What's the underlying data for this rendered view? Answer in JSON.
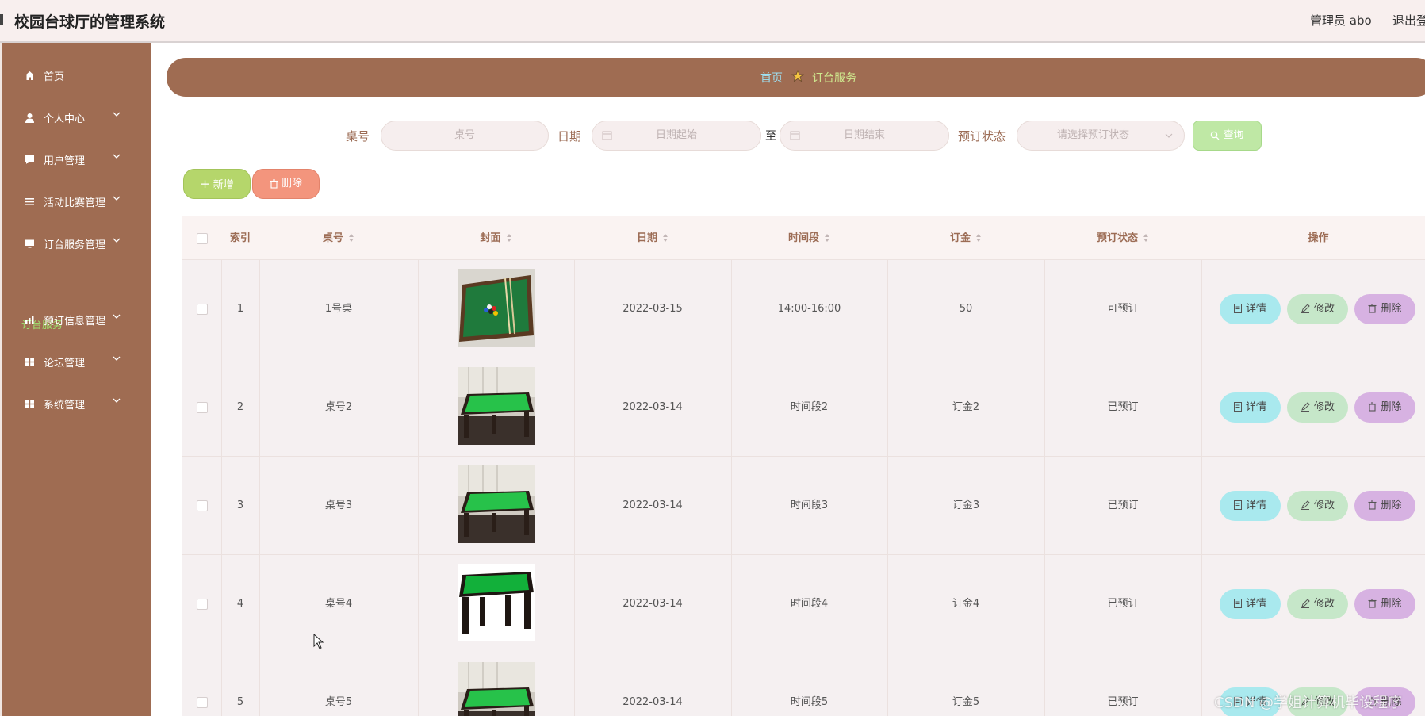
{
  "header": {
    "title": "校园台球厅的管理系统",
    "admin": "管理员 abo",
    "logout": "退出登"
  },
  "sidebar": {
    "items": [
      {
        "label": "首页",
        "icon": "home-icon"
      },
      {
        "label": "个人中心",
        "icon": "user-icon"
      },
      {
        "label": "用户管理",
        "icon": "chat-icon"
      },
      {
        "label": "活动比赛管理",
        "icon": "list-icon"
      },
      {
        "label": "订台服务管理",
        "icon": "monitor-icon"
      },
      {
        "label": "预订信息管理",
        "icon": "chart-icon"
      },
      {
        "label": "论坛管理",
        "icon": "grid-icon"
      },
      {
        "label": "系统管理",
        "icon": "grid-icon"
      }
    ],
    "active_sub": "订台服务"
  },
  "breadcrumb": {
    "home": "首页",
    "current": "订台服务"
  },
  "search": {
    "table_label": "桌号",
    "table_placeholder": "桌号",
    "date_label": "日期",
    "date_start_placeholder": "日期起始",
    "date_sep": "至",
    "date_end_placeholder": "日期结束",
    "status_label": "预订状态",
    "status_placeholder": "请选择预订状态",
    "query_label": "查询"
  },
  "actions": {
    "add_label": "新增",
    "delete_label": "删除"
  },
  "table": {
    "columns": [
      "索引",
      "桌号",
      "封面",
      "日期",
      "时间段",
      "订金",
      "预订状态",
      "操作"
    ],
    "rows": [
      {
        "index": "1",
        "table_no": "1号桌",
        "cover": "pool-table-top-view",
        "date": "2022-03-15",
        "period": "14:00-16:00",
        "deposit": "50",
        "status": "可预订"
      },
      {
        "index": "2",
        "table_no": "桌号2",
        "cover": "green-pool-table-room",
        "date": "2022-03-14",
        "period": "时间段2",
        "deposit": "订金2",
        "status": "已预订"
      },
      {
        "index": "3",
        "table_no": "桌号3",
        "cover": "green-pool-table-room",
        "date": "2022-03-14",
        "period": "时间段3",
        "deposit": "订金3",
        "status": "已预订"
      },
      {
        "index": "4",
        "table_no": "桌号4",
        "cover": "green-pool-table-white",
        "date": "2022-03-14",
        "period": "时间段4",
        "deposit": "订金4",
        "status": "已预订"
      },
      {
        "index": "5",
        "table_no": "桌号5",
        "cover": "green-pool-table-room",
        "date": "2022-03-14",
        "period": "时间段5",
        "deposit": "订金5",
        "status": "已预订"
      }
    ],
    "row_actions": {
      "detail": "详情",
      "edit": "修改",
      "delete": "删除"
    }
  },
  "watermark": "CSDN @学姐计算机毕设程序",
  "colors": {
    "sidebar": "#9f6c52",
    "header": "#f8efee",
    "accent_green": "#9fe26f",
    "detail_btn": "#a9e9ee",
    "edit_btn": "#c6e7c9",
    "delete_btn": "#d7b2e2"
  }
}
